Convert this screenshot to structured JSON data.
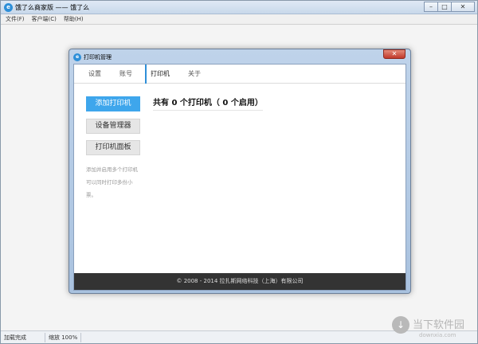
{
  "window": {
    "title": "饿了么商家版 —— 饿了么",
    "icon": "eleme-logo-icon",
    "controls": [
      "minimize",
      "maximize",
      "close"
    ]
  },
  "menu": [
    "文件(F)",
    "客户端(C)",
    "帮助(H)"
  ],
  "dialog": {
    "title": "打印机管理",
    "tabs": [
      {
        "label": "设置",
        "active": false
      },
      {
        "label": "账号",
        "active": false
      },
      {
        "label": "打印机",
        "active": true
      },
      {
        "label": "关于",
        "active": false
      }
    ],
    "buttons": {
      "add_printer": "添加打印机",
      "device_manager": "设备管理器",
      "printer_panel": "打印机面板"
    },
    "help_text": "添加并启用多个打印机可以同时打印多份小票。",
    "summary": "共有 0 个打印机（ 0 个启用）",
    "footer": "© 2008 - 2014 拉扎斯网络科技（上海）有限公司"
  },
  "status": {
    "load": "加载完成",
    "zoom": "缩放 100%"
  },
  "watermark": {
    "text": "当下软件园",
    "url": "downxia.com"
  },
  "colors": {
    "primary": "#3ea6ec",
    "footer_bg": "#333333",
    "close_button": "#c0392b"
  }
}
